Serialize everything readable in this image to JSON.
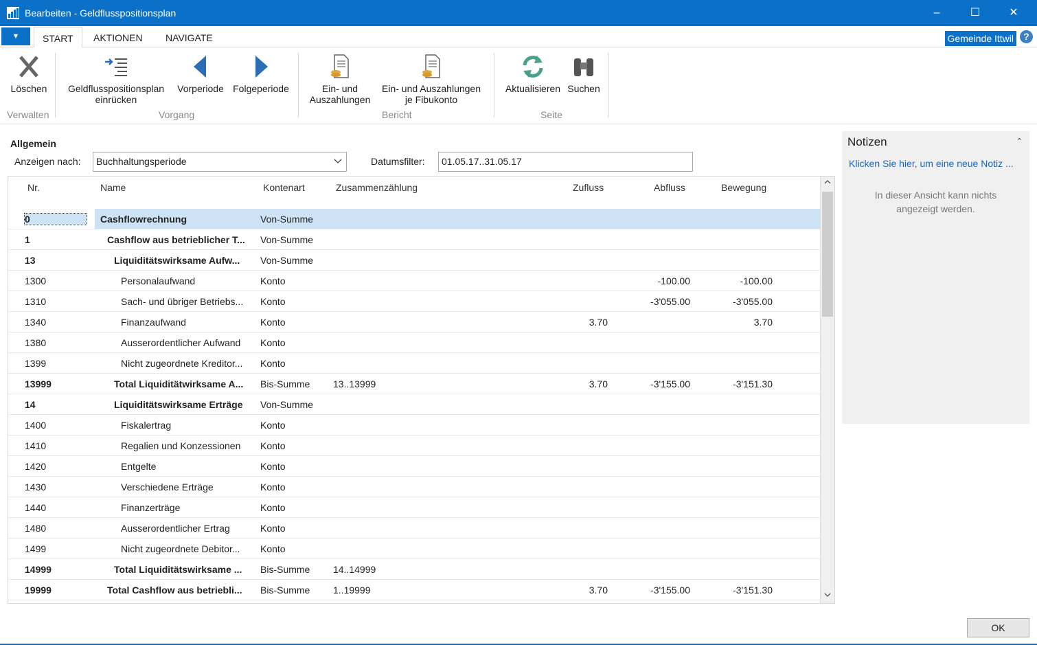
{
  "window": {
    "title": "Bearbeiten - Geldflusspositionsplan",
    "minimize": "–",
    "maximize": "☐",
    "close": "✕"
  },
  "tabs": {
    "file": "▼",
    "start": "START",
    "aktionen": "AKTIONEN",
    "navigate": "NAVIGATE"
  },
  "company": "Gemeinde Ittwil",
  "help": "?",
  "ribbon": {
    "loeschen": "Löschen",
    "einruecken_line1": "Geldflusspositionsplan",
    "einruecken_line2": "einrücken",
    "vorperiode": "Vorperiode",
    "folgeperiode": "Folgeperiode",
    "ein_aus_line1": "Ein- und",
    "ein_aus_line2": "Auszahlungen",
    "ein_aus_fibu_line1": "Ein- und Auszahlungen",
    "ein_aus_fibu_line2": "je Fibukonto",
    "aktualisieren": "Aktualisieren",
    "suchen": "Suchen",
    "groups": {
      "verwalten": "Verwalten",
      "vorgang": "Vorgang",
      "bericht": "Bericht",
      "seite": "Seite"
    }
  },
  "general": {
    "title": "Allgemein",
    "view_by_label": "Anzeigen nach:",
    "view_by_value": "Buchhaltungsperiode",
    "date_filter_label": "Datumsfilter:",
    "date_filter_value": "01.05.17..31.05.17"
  },
  "columns": {
    "nr": "Nr.",
    "name": "Name",
    "kontenart": "Kontenart",
    "zusammenzaehlung": "Zusammenzählung",
    "zufluss": "Zufluss",
    "abfluss": "Abfluss",
    "bewegung": "Bewegung"
  },
  "rows": [
    {
      "nr": "0",
      "name": "Cashflowrechnung",
      "art": "Von-Summe",
      "sum": "",
      "zu": "",
      "ab": "",
      "bew": "",
      "bold": true,
      "indent": 0
    },
    {
      "nr": "1",
      "name": "Cashflow aus betrieblicher T...",
      "art": "Von-Summe",
      "sum": "",
      "zu": "",
      "ab": "",
      "bew": "",
      "bold": true,
      "indent": 1
    },
    {
      "nr": "13",
      "name": "Liquiditätswirksame Aufw...",
      "art": "Von-Summe",
      "sum": "",
      "zu": "",
      "ab": "",
      "bew": "",
      "bold": true,
      "indent": 2
    },
    {
      "nr": "1300",
      "name": "Personalaufwand",
      "art": "Konto",
      "sum": "",
      "zu": "",
      "ab": "-100.00",
      "bew": "-100.00",
      "bold": false,
      "indent": 3
    },
    {
      "nr": "1310",
      "name": "Sach- und übriger Betriebs...",
      "art": "Konto",
      "sum": "",
      "zu": "",
      "ab": "-3'055.00",
      "bew": "-3'055.00",
      "bold": false,
      "indent": 3
    },
    {
      "nr": "1340",
      "name": "Finanzaufwand",
      "art": "Konto",
      "sum": "",
      "zu": "3.70",
      "ab": "",
      "bew": "3.70",
      "bold": false,
      "indent": 3
    },
    {
      "nr": "1380",
      "name": "Ausserordentlicher Aufwand",
      "art": "Konto",
      "sum": "",
      "zu": "",
      "ab": "",
      "bew": "",
      "bold": false,
      "indent": 3
    },
    {
      "nr": "1399",
      "name": "Nicht zugeordnete Kreditor...",
      "art": "Konto",
      "sum": "",
      "zu": "",
      "ab": "",
      "bew": "",
      "bold": false,
      "indent": 3
    },
    {
      "nr": "13999",
      "name": "Total Liquiditätwirksame A...",
      "art": "Bis-Summe",
      "sum": "13..13999",
      "zu": "3.70",
      "ab": "-3'155.00",
      "bew": "-3'151.30",
      "bold": true,
      "indent": 2
    },
    {
      "nr": "14",
      "name": "Liquiditätswirksame Erträge",
      "art": "Von-Summe",
      "sum": "",
      "zu": "",
      "ab": "",
      "bew": "",
      "bold": true,
      "indent": 2
    },
    {
      "nr": "1400",
      "name": "Fiskalertrag",
      "art": "Konto",
      "sum": "",
      "zu": "",
      "ab": "",
      "bew": "",
      "bold": false,
      "indent": 3
    },
    {
      "nr": "1410",
      "name": "Regalien und Konzessionen",
      "art": "Konto",
      "sum": "",
      "zu": "",
      "ab": "",
      "bew": "",
      "bold": false,
      "indent": 3
    },
    {
      "nr": "1420",
      "name": "Entgelte",
      "art": "Konto",
      "sum": "",
      "zu": "",
      "ab": "",
      "bew": "",
      "bold": false,
      "indent": 3
    },
    {
      "nr": "1430",
      "name": "Verschiedene Erträge",
      "art": "Konto",
      "sum": "",
      "zu": "",
      "ab": "",
      "bew": "",
      "bold": false,
      "indent": 3
    },
    {
      "nr": "1440",
      "name": "Finanzerträge",
      "art": "Konto",
      "sum": "",
      "zu": "",
      "ab": "",
      "bew": "",
      "bold": false,
      "indent": 3
    },
    {
      "nr": "1480",
      "name": "Ausserordentlicher Ertrag",
      "art": "Konto",
      "sum": "",
      "zu": "",
      "ab": "",
      "bew": "",
      "bold": false,
      "indent": 3
    },
    {
      "nr": "1499",
      "name": "Nicht zugeordnete Debitor...",
      "art": "Konto",
      "sum": "",
      "zu": "",
      "ab": "",
      "bew": "",
      "bold": false,
      "indent": 3
    },
    {
      "nr": "14999",
      "name": "Total Liquiditätswirksame ...",
      "art": "Bis-Summe",
      "sum": "14..14999",
      "zu": "",
      "ab": "",
      "bew": "",
      "bold": true,
      "indent": 2
    },
    {
      "nr": "19999",
      "name": "Total Cashflow aus betriebli...",
      "art": "Bis-Summe",
      "sum": "1..19999",
      "zu": "3.70",
      "ab": "-3'155.00",
      "bew": "-3'151.30",
      "bold": true,
      "indent": 1
    }
  ],
  "notes": {
    "title": "Notizen",
    "collapse": "⌃",
    "link": "Klicken Sie hier, um eine neue Notiz ...",
    "empty": "In dieser Ansicht kann nichts angezeigt werden."
  },
  "ok": "OK",
  "colors": {
    "accent": "#0a70c8",
    "selection": "#cde3f5",
    "link": "#1a64b8"
  }
}
